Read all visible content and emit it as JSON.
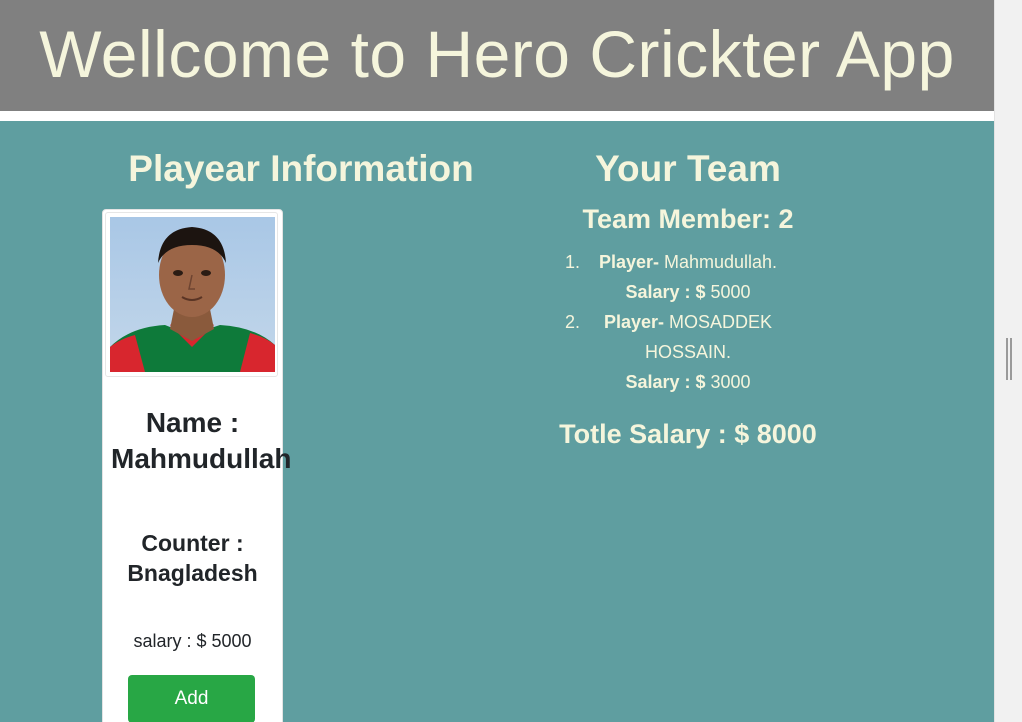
{
  "header": {
    "title": "Wellcome to Hero Crickter App"
  },
  "player_section": {
    "title": "Playear Information",
    "card": {
      "name_label": "Name : Mahmudullah",
      "country_label": "Counter : Bnagladesh",
      "salary_label": "salary : $ 5000",
      "add_button": "Add"
    }
  },
  "team_section": {
    "title": "Your Team",
    "member_count_label": "Team Member: 2",
    "members": [
      {
        "number": "1.",
        "player_label": "Player-",
        "player_name": "Mahmudullah.",
        "salary_label": "Salary : $",
        "salary_value": "5000"
      },
      {
        "number": "2.",
        "player_label": "Player-",
        "player_name": "MOSADDEK",
        "player_name_cont": "HOSSAIN.",
        "salary_label": "Salary : $",
        "salary_value": "3000"
      }
    ],
    "total_label": "Totle Salary : $ 8000"
  },
  "colors": {
    "header_bg": "#808080",
    "main_bg": "#5f9ea0",
    "text_light": "#f5f5dc",
    "button_green": "#28a745"
  }
}
